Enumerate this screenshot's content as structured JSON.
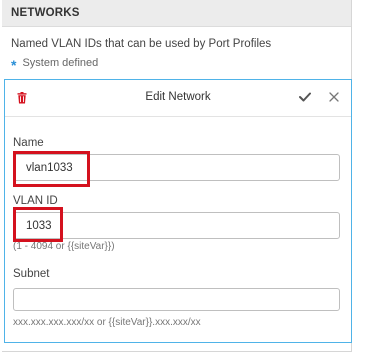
{
  "networks": {
    "title": "NETWORKS",
    "description": "Named VLAN IDs that can be used by Port Profiles",
    "system_defined_marker": "*",
    "system_defined_label": "System defined"
  },
  "edit_network": {
    "title": "Edit Network",
    "icons": {
      "delete": "trash-icon",
      "save": "check-icon",
      "close": "close-icon"
    },
    "colors": {
      "delete_icon": "#d4111e",
      "panel_border": "#4fb3e8",
      "star": "#2a8fd6",
      "highlight": "#d4111e"
    },
    "fields": {
      "name": {
        "label": "Name",
        "value": "vlan1033"
      },
      "vlan_id": {
        "label": "VLAN ID",
        "value": "1033",
        "hint": "(1 - 4094 or {{siteVar}})"
      },
      "subnet": {
        "label": "Subnet",
        "value": "",
        "hint": "xxx.xxx.xxx.xxx/xx or {{siteVar}}.xxx.xxx/xx"
      }
    }
  }
}
